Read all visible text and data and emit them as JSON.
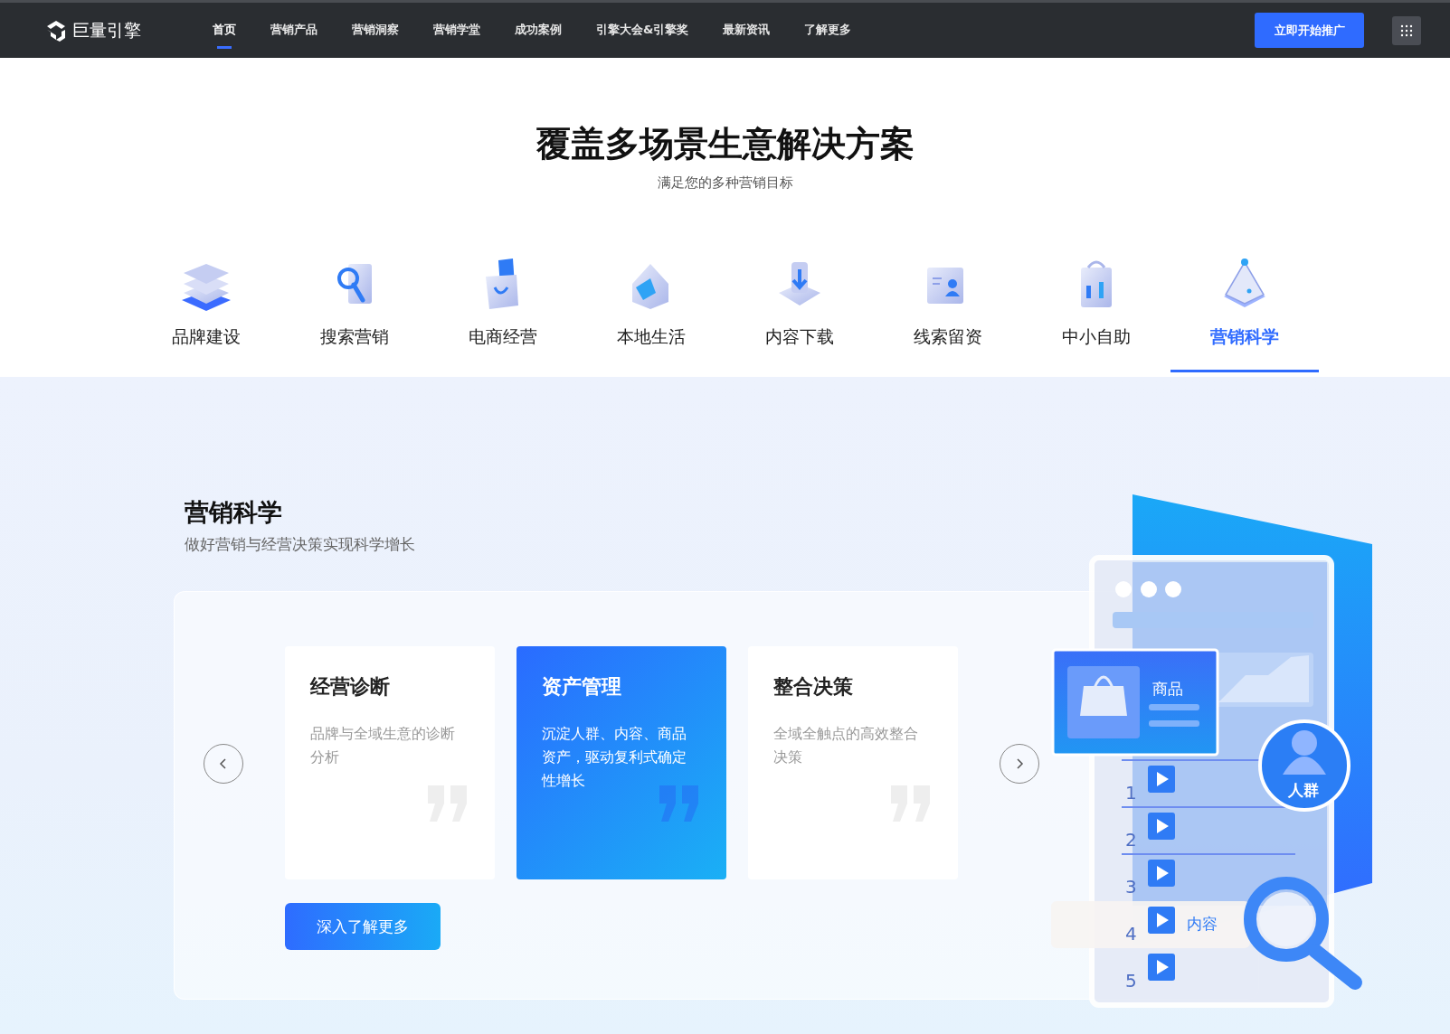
{
  "nav": {
    "logo": "巨量引擎",
    "items": [
      {
        "label": "首页",
        "selected": true
      },
      {
        "label": "营销产品",
        "selected": false
      },
      {
        "label": "营销洞察",
        "selected": false
      },
      {
        "label": "营销学堂",
        "selected": false
      },
      {
        "label": "成功案例",
        "selected": false
      },
      {
        "label": "引擎大会&引擎奖",
        "selected": false
      },
      {
        "label": "最新资讯",
        "selected": false
      },
      {
        "label": "了解更多",
        "selected": false
      }
    ],
    "cta": "立即开始推广"
  },
  "heading": {
    "title": "覆盖多场景生意解决方案",
    "subtitle": "满足您的多种营销目标"
  },
  "tabs": [
    {
      "label": "品牌建设",
      "selected": false
    },
    {
      "label": "搜索营销",
      "selected": false
    },
    {
      "label": "电商经营",
      "selected": false
    },
    {
      "label": "本地生活",
      "selected": false
    },
    {
      "label": "内容下载",
      "selected": false
    },
    {
      "label": "线索留资",
      "selected": false
    },
    {
      "label": "中小自助",
      "selected": false
    },
    {
      "label": "营销科学",
      "selected": true
    }
  ],
  "section": {
    "title": "营销科学",
    "subtitle": "做好营销与经营决策实现科学增长",
    "cards": [
      {
        "title": "经营诊断",
        "text": "品牌与全域生意的诊断分析",
        "selected": false
      },
      {
        "title": "资产管理",
        "text": "沉淀人群、内容、商品资产，驱动复利式确定性增长",
        "selected": true
      },
      {
        "title": "整合决策",
        "text": "全域全触点的高效整合决策",
        "selected": false
      }
    ],
    "button": "深入了解更多"
  },
  "illustration": {
    "product_label": "商品",
    "audience_label": "人群",
    "content_label": "内容",
    "rows": [
      "1",
      "2",
      "3",
      "4",
      "5"
    ]
  }
}
